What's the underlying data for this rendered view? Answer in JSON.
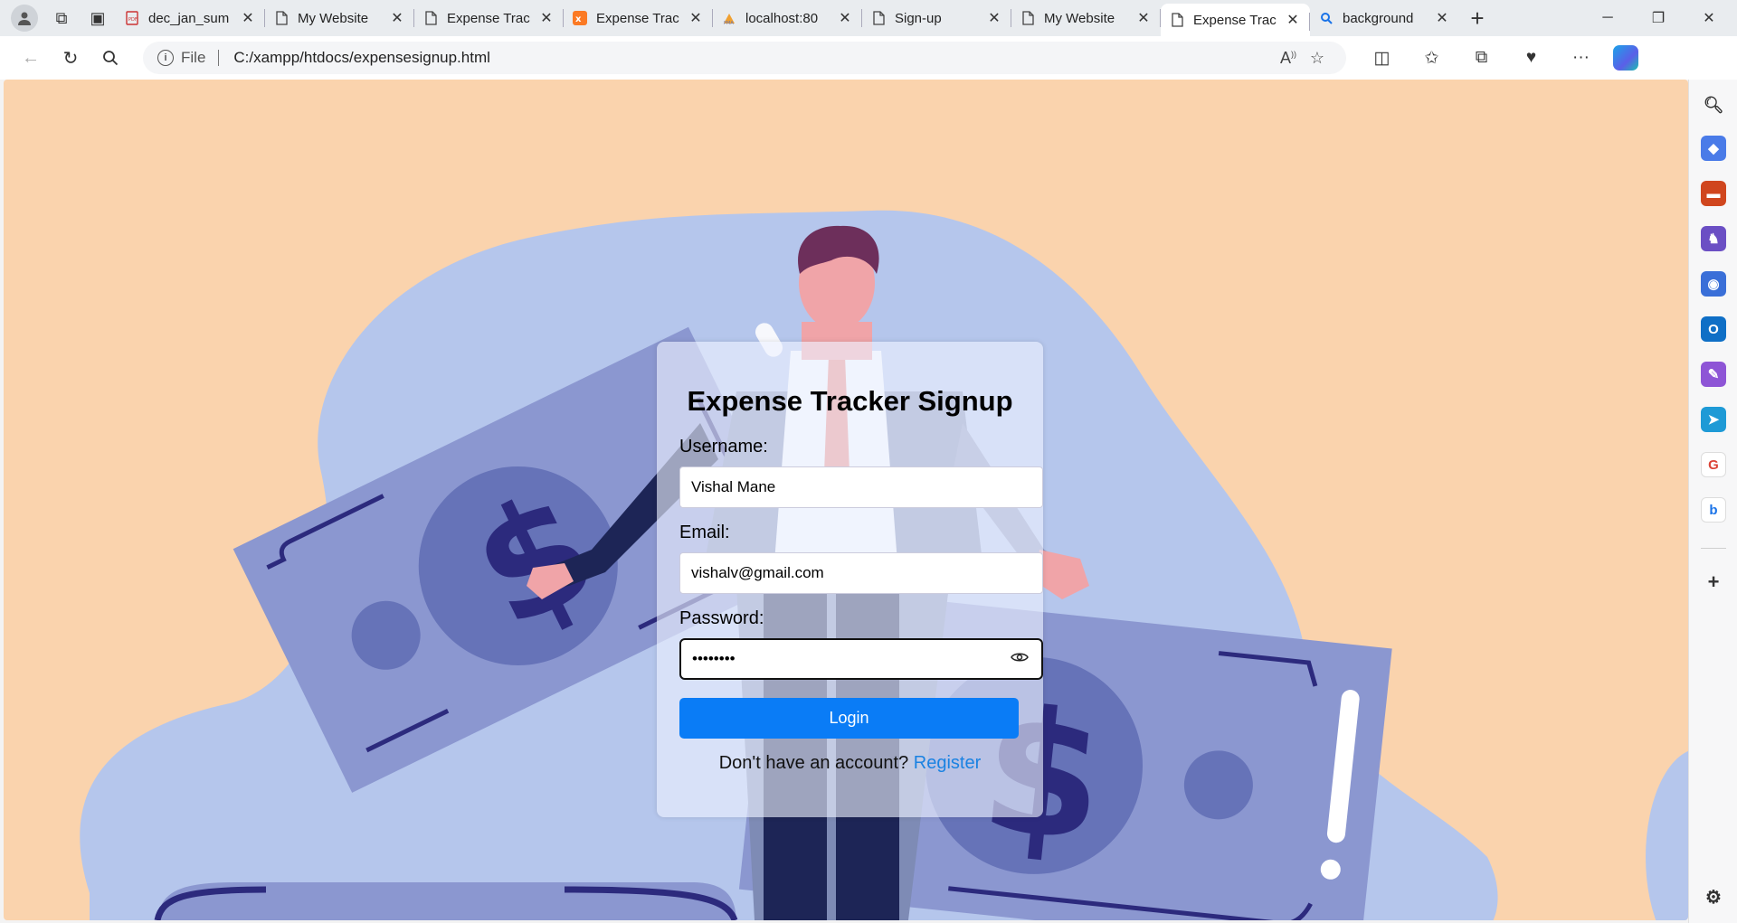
{
  "browser": {
    "tabs": [
      {
        "label": "dec_jan_sum",
        "icon": "pdf-icon",
        "active": false
      },
      {
        "label": "My Website",
        "icon": "page-icon",
        "active": false
      },
      {
        "label": "Expense Trac",
        "icon": "page-icon",
        "active": false
      },
      {
        "label": "Expense Trac",
        "icon": "xampp-icon",
        "active": false
      },
      {
        "label": "localhost:80",
        "icon": "phpmyadmin-icon",
        "active": false
      },
      {
        "label": "Sign-up",
        "icon": "page-icon",
        "active": false
      },
      {
        "label": "My Website",
        "icon": "page-icon",
        "active": false
      },
      {
        "label": "Expense Trac",
        "icon": "page-icon",
        "active": true
      },
      {
        "label": "background",
        "icon": "search-icon",
        "active": false
      }
    ],
    "address": {
      "info_label": "File",
      "url": "C:/xampp/htdocs/expensesignup.html"
    }
  },
  "form": {
    "title": "Expense Tracker Signup",
    "username_label": "Username:",
    "username_value": "Vishal Mane",
    "email_label": "Email:",
    "email_value": "vishalv@gmail.com",
    "password_label": "Password:",
    "password_value": "••••••••",
    "login_label": "Login",
    "footer_text": "Don't have an account?",
    "register_link": "Register"
  },
  "colors": {
    "background_peach": "#fad3ad",
    "blob_blue": "#b5c6ec",
    "bill_purple": "#8b97d0",
    "button_blue": "#0a7cf6",
    "link_blue": "#1a82e2"
  }
}
